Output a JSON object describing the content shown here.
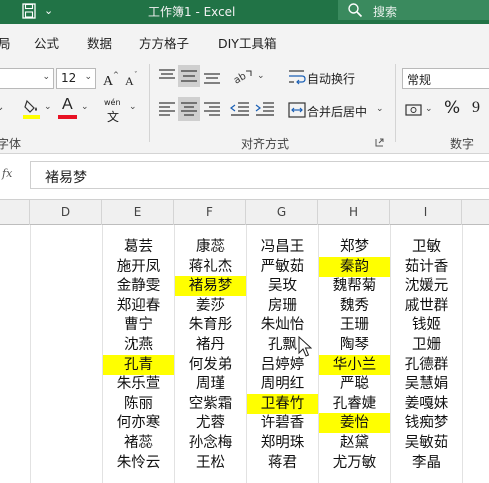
{
  "titlebar": {
    "title": "工作簿1 - Excel",
    "search_label": "搜索",
    "bg_color": "#217346"
  },
  "tabs": [
    "局",
    "公式",
    "数据",
    "方方格子",
    "DIY工具箱"
  ],
  "ribbon": {
    "font_size": "12",
    "wrap_text": "自动换行",
    "merge_center": "合并后居中",
    "number_format": "常规",
    "percent_symbol": "%",
    "comma_symbol": "9",
    "group_font": "字体",
    "group_align": "对齐方式",
    "group_number": "数字",
    "wen_top": "wén",
    "wen_bottom": "文",
    "font_a": "A",
    "accent_red": "#e81123",
    "accent_yellow": "#ffff00"
  },
  "formula_bar": {
    "fx": "fx",
    "value": "褚易梦"
  },
  "columns": [
    "D",
    "E",
    "F",
    "G",
    "H",
    "I"
  ],
  "rows": [
    [
      {
        "t": ""
      },
      {
        "t": "葛芸"
      },
      {
        "t": "康蕊"
      },
      {
        "t": "冯昌王"
      },
      {
        "t": "郑梦"
      },
      {
        "t": "卫敏"
      }
    ],
    [
      {
        "t": ""
      },
      {
        "t": "施开凤"
      },
      {
        "t": "蒋礼杰"
      },
      {
        "t": "严敏茹"
      },
      {
        "t": "秦韵",
        "hl": true
      },
      {
        "t": "茹计香"
      }
    ],
    [
      {
        "t": ""
      },
      {
        "t": "金静雯"
      },
      {
        "t": "褚易梦",
        "hl": true
      },
      {
        "t": "吴玫"
      },
      {
        "t": "魏帮菊"
      },
      {
        "t": "沈媛元"
      }
    ],
    [
      {
        "t": ""
      },
      {
        "t": "郑迎春"
      },
      {
        "t": "姜莎"
      },
      {
        "t": "房珊"
      },
      {
        "t": "魏秀"
      },
      {
        "t": "戚世群"
      }
    ],
    [
      {
        "t": ""
      },
      {
        "t": "曹宁"
      },
      {
        "t": "朱育彤"
      },
      {
        "t": "朱灿怡"
      },
      {
        "t": "王珊"
      },
      {
        "t": "钱姬"
      }
    ],
    [
      {
        "t": ""
      },
      {
        "t": "沈燕"
      },
      {
        "t": "褚丹"
      },
      {
        "t": "孔飘"
      },
      {
        "t": "陶琴"
      },
      {
        "t": "卫姗"
      }
    ],
    [
      {
        "t": ""
      },
      {
        "t": "孔青",
        "hl": true
      },
      {
        "t": "何发弟"
      },
      {
        "t": "吕婷婷"
      },
      {
        "t": "华小兰",
        "hl": true
      },
      {
        "t": "孔德群"
      }
    ],
    [
      {
        "t": ""
      },
      {
        "t": "朱乐萱"
      },
      {
        "t": "周瑾"
      },
      {
        "t": "周明红"
      },
      {
        "t": "严聪"
      },
      {
        "t": "吴慧娟"
      }
    ],
    [
      {
        "t": ""
      },
      {
        "t": "陈丽"
      },
      {
        "t": "空紫霜"
      },
      {
        "t": "卫春竹",
        "hl": true
      },
      {
        "t": "孔睿婕"
      },
      {
        "t": "姜嘎妹"
      }
    ],
    [
      {
        "t": ""
      },
      {
        "t": "何亦寒"
      },
      {
        "t": "尤蓉"
      },
      {
        "t": "许碧香"
      },
      {
        "t": "姜怡",
        "hl": true
      },
      {
        "t": "钱痴梦"
      }
    ],
    [
      {
        "t": ""
      },
      {
        "t": "褚蕊"
      },
      {
        "t": "孙念梅"
      },
      {
        "t": "郑明珠"
      },
      {
        "t": "赵黛"
      },
      {
        "t": "吴敏茹"
      }
    ],
    [
      {
        "t": ""
      },
      {
        "t": "朱怜云"
      },
      {
        "t": "王松"
      },
      {
        "t": "蒋君"
      },
      {
        "t": "尤万敏"
      },
      {
        "t": "李晶"
      }
    ]
  ]
}
